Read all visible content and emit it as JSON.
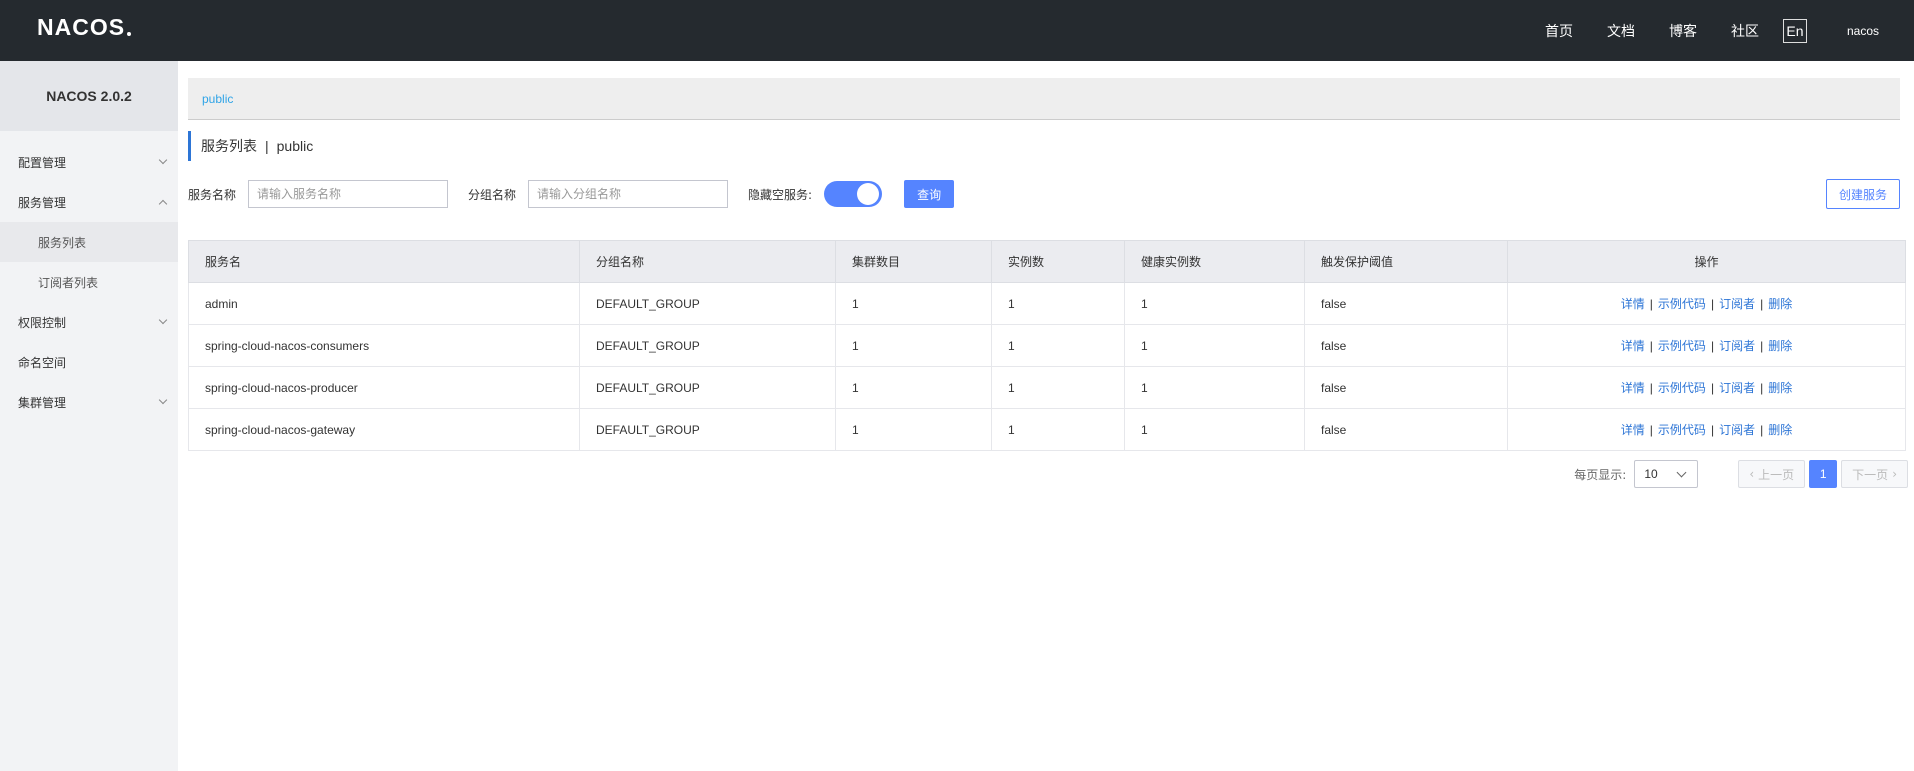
{
  "header": {
    "logo": "NACOS",
    "nav": [
      "首页",
      "文档",
      "博客",
      "社区"
    ],
    "lang": "En",
    "user": "nacos"
  },
  "sidebar": {
    "version": "NACOS 2.0.2",
    "items": [
      {
        "label": "配置管理"
      },
      {
        "label": "服务管理"
      },
      {
        "label": "服务列表"
      },
      {
        "label": "订阅者列表"
      },
      {
        "label": "权限控制"
      },
      {
        "label": "命名空间"
      },
      {
        "label": "集群管理"
      }
    ]
  },
  "breadcrumb": {
    "namespace": "public"
  },
  "page": {
    "title": "服务列表",
    "namespace": "public"
  },
  "filters": {
    "service_label": "服务名称",
    "service_placeholder": "请输入服务名称",
    "group_label": "分组名称",
    "group_placeholder": "请输入分组名称",
    "hide_empty_label": "隐藏空服务:",
    "hide_empty_on": true,
    "query_button": "查询",
    "create_button": "创建服务"
  },
  "table": {
    "columns": [
      "服务名",
      "分组名称",
      "集群数目",
      "实例数",
      "健康实例数",
      "触发保护阈值",
      "操作"
    ],
    "rows": [
      [
        "admin",
        "DEFAULT_GROUP",
        "1",
        "1",
        "1",
        "false"
      ],
      [
        "spring-cloud-nacos-consumers",
        "DEFAULT_GROUP",
        "1",
        "1",
        "1",
        "false"
      ],
      [
        "spring-cloud-nacos-producer",
        "DEFAULT_GROUP",
        "1",
        "1",
        "1",
        "false"
      ],
      [
        "spring-cloud-nacos-gateway",
        "DEFAULT_GROUP",
        "1",
        "1",
        "1",
        "false"
      ]
    ],
    "actions": [
      "详情",
      "示例代码",
      "订阅者",
      "删除"
    ]
  },
  "pagination": {
    "page_size_label": "每页显示:",
    "page_size": "10",
    "prev": "上一页",
    "current": "1",
    "next": "下一页"
  },
  "colors": {
    "primary": "#5584ff",
    "link": "#2d75d6",
    "header_bg": "#252a2f",
    "sidebar_bg": "#f2f3f5"
  }
}
